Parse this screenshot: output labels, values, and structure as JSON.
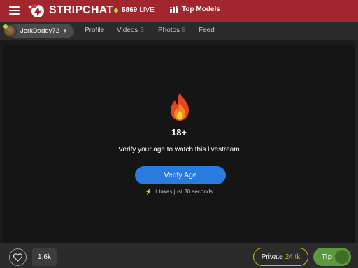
{
  "header": {
    "brand": "STRIPCHAT",
    "live_count": "5869",
    "live_label": "LIVE",
    "top_models_label": "Top Models"
  },
  "profile_nav": {
    "username": "JerkDaddy72",
    "items": [
      {
        "label": "Profile",
        "count": ""
      },
      {
        "label": "Videos",
        "count": "3"
      },
      {
        "label": "Photos",
        "count": "8"
      },
      {
        "label": "Feed",
        "count": ""
      }
    ]
  },
  "age_gate": {
    "heading": "18+",
    "message": "Verify your age to watch this livestream",
    "button_label": "Verify Age",
    "hint": "It takes just 30 seconds"
  },
  "footer": {
    "likes": "1.6k",
    "private_label": "Private",
    "private_price": "24 tk",
    "tip_label": "Tip"
  },
  "colors": {
    "header_bg": "#a2262e",
    "accent_blue": "#2a7be0",
    "private_gold": "#e3b01f",
    "tip_green": "#5a9a3a",
    "live_dot": "#b5d535"
  },
  "icons": [
    "hamburger-icon",
    "stripchat-logo-icon",
    "top-models-icon",
    "chevron-down-icon",
    "fire-icon",
    "lightning-icon",
    "heart-icon"
  ]
}
